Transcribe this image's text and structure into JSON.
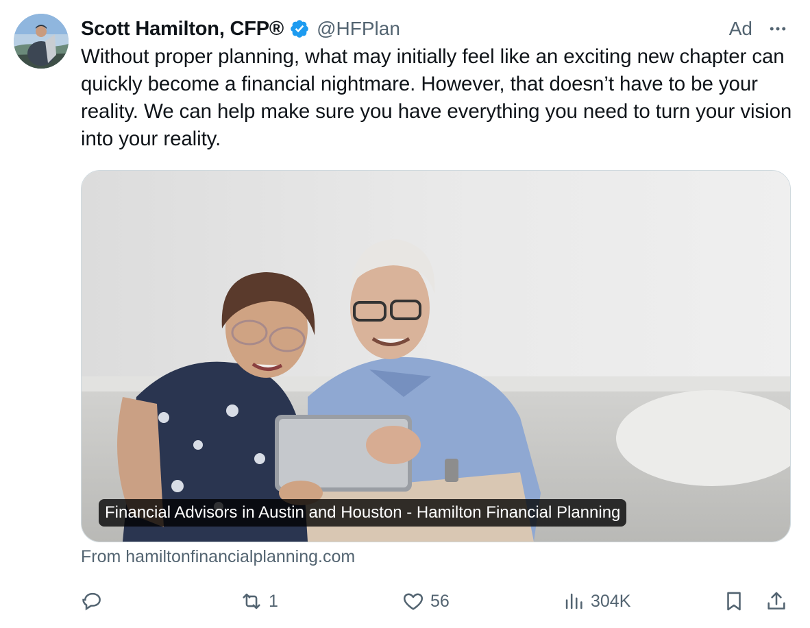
{
  "author": {
    "display_name": "Scott Hamilton, CFP®",
    "handle": "@HFPlan",
    "verified_icon": "verified-badge-icon",
    "avatar": "avatar-photo"
  },
  "ad_label": "Ad",
  "tweet_text": "Without proper planning, what may initially feel like an exciting new chapter can quickly become a financial nightmare. However, that doesn’t have to be your reality. We can help make sure you have everything you need to turn your vision into your reality.",
  "card": {
    "title": "Financial Advisors in Austin and Houston - Hamilton Financial Planning",
    "source": "From hamiltonfinancialplanning.com"
  },
  "actions": {
    "reply": {
      "icon": "reply-icon",
      "count": ""
    },
    "repost": {
      "icon": "repost-icon",
      "count": "1"
    },
    "like": {
      "icon": "heart-icon",
      "count": "56"
    },
    "views": {
      "icon": "views-chart-icon",
      "count": "304K"
    },
    "bookmark": {
      "icon": "bookmark-icon"
    },
    "share": {
      "icon": "share-icon"
    }
  },
  "colors": {
    "text_primary": "#0f1419",
    "text_secondary": "#536471",
    "verified_blue": "#1d9bf0",
    "card_border": "#cfd9de"
  }
}
